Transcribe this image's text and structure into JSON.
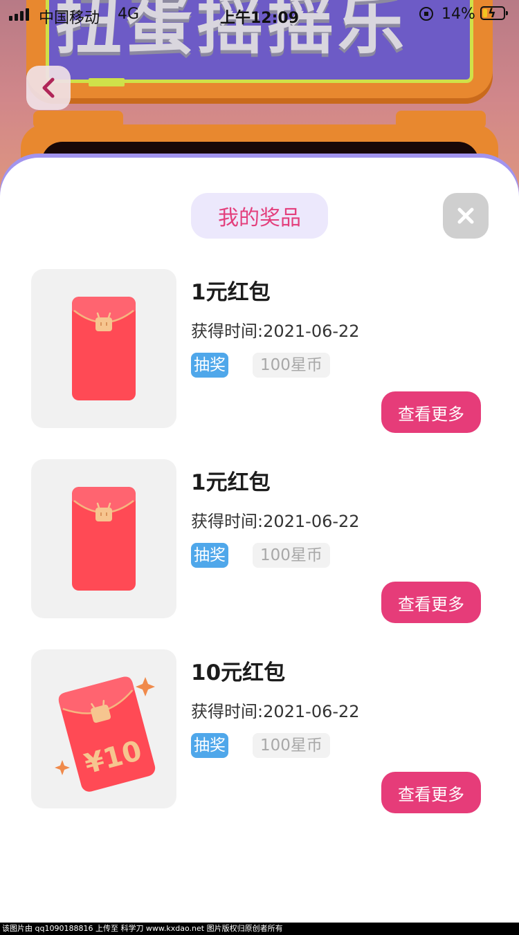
{
  "status_bar": {
    "carrier": "中国移动",
    "network": "4G",
    "time": "上午12:09",
    "battery": "14%"
  },
  "header": {
    "banner_text": "扭蛋摇摇乐"
  },
  "modal": {
    "title": "我的奖品",
    "items": [
      {
        "name": "1元红包",
        "date": "获得时间:2021-06-22",
        "source": "抽奖",
        "price": "100星币",
        "button": "查看更多",
        "image": "red-envelope-icon"
      },
      {
        "name": "1元红包",
        "date": "获得时间:2021-06-22",
        "source": "抽奖",
        "price": "100星币",
        "button": "查看更多",
        "image": "red-envelope-icon"
      },
      {
        "name": "10元红包",
        "date": "获得时间:2021-06-22",
        "source": "抽奖",
        "price": "100星币",
        "button": "查看更多",
        "image": "red-envelope-10-icon",
        "image_text": "¥10"
      }
    ]
  },
  "watermark": "该图片由 qq1090188816 上传至 科学刀 www.kxdao.net 图片版权归原创者所有",
  "colors": {
    "accent_pink": "#e63c79",
    "tag_blue": "#4fa7ea",
    "title_bg": "#ece8fc"
  }
}
